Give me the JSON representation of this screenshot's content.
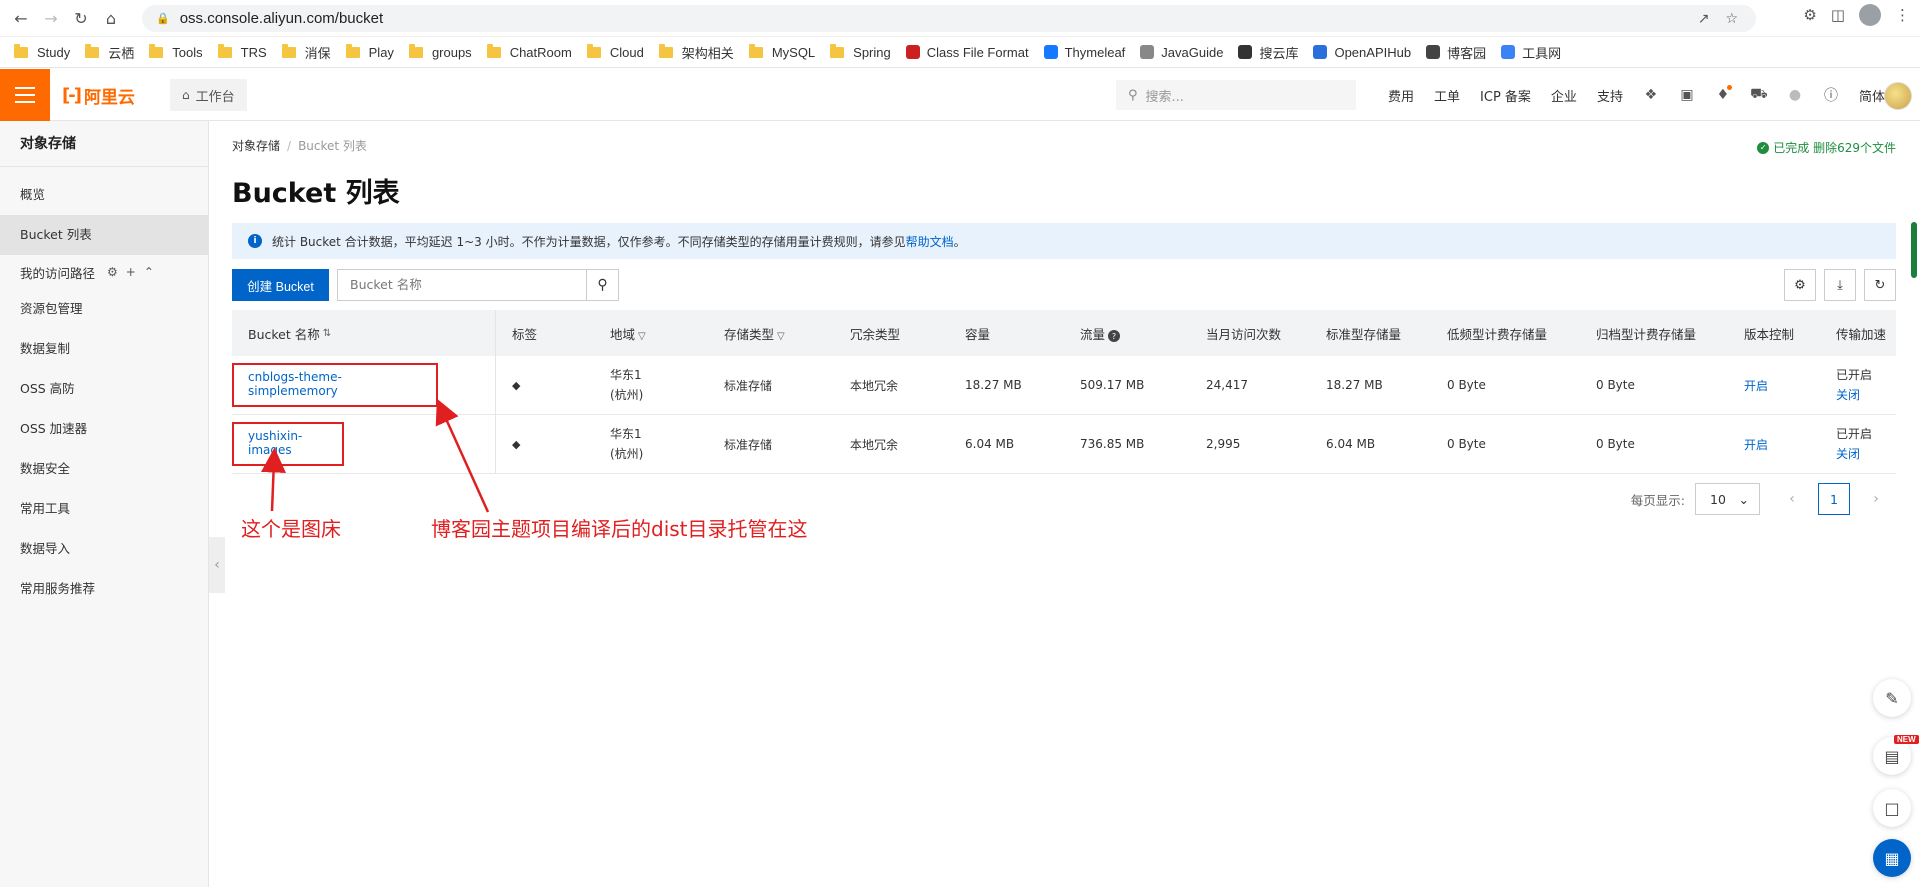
{
  "browser": {
    "url": "oss.console.aliyun.com/bucket",
    "bookmarks": [
      {
        "label": "Study",
        "type": "folder"
      },
      {
        "label": "云栖",
        "type": "folder"
      },
      {
        "label": "Tools",
        "type": "folder"
      },
      {
        "label": "TRS",
        "type": "folder"
      },
      {
        "label": "消保",
        "type": "folder"
      },
      {
        "label": "Play",
        "type": "folder"
      },
      {
        "label": "groups",
        "type": "folder"
      },
      {
        "label": "ChatRoom",
        "type": "folder"
      },
      {
        "label": "Cloud",
        "type": "folder"
      },
      {
        "label": "架构相关",
        "type": "folder"
      },
      {
        "label": "MySQL",
        "type": "folder"
      },
      {
        "label": "Spring",
        "type": "folder"
      },
      {
        "label": "Class File Format",
        "type": "site",
        "color": "#cc1f1f"
      },
      {
        "label": "Thymeleaf",
        "type": "site",
        "color": "#1677ff"
      },
      {
        "label": "JavaGuide",
        "type": "site",
        "color": "#888888"
      },
      {
        "label": "搜云库",
        "type": "site",
        "color": "#333333"
      },
      {
        "label": "OpenAPIHub",
        "type": "site",
        "color": "#2a6fdb"
      },
      {
        "label": "博客园",
        "type": "site",
        "color": "#444444"
      },
      {
        "label": "工具网",
        "type": "site",
        "color": "#3b82f6"
      }
    ]
  },
  "header": {
    "logo": "阿里云",
    "workbench": "工作台",
    "search_placeholder": "搜索...",
    "menu": [
      "费用",
      "工单",
      "ICP 备案",
      "企业",
      "支持"
    ],
    "lang": "简体"
  },
  "sidebar": {
    "title": "对象存储",
    "items_top": [
      "概览",
      "Bucket 列表"
    ],
    "group_label": "我的访问路径",
    "items_bottom": [
      "资源包管理",
      "数据复制",
      "OSS 高防",
      "OSS 加速器",
      "数据安全",
      "常用工具",
      "数据导入",
      "常用服务推荐"
    ]
  },
  "main": {
    "breadcrumb": [
      "对象存储",
      "Bucket 列表"
    ],
    "status": "已完成 删除629个文件",
    "title": "Bucket 列表",
    "banner_text": "统计 Bucket 合计数据，平均延迟 1~3 小时。不作为计量数据，仅作参考。不同存储类型的存储用量计费规则，请参见",
    "banner_link": "帮助文档",
    "banner_end": "。",
    "create_button": "创建 Bucket",
    "search_placeholder": "Bucket 名称"
  },
  "table": {
    "headers": [
      "Bucket 名称",
      "标签",
      "地域",
      "存储类型",
      "冗余类型",
      "容量",
      "流量",
      "当月访问次数",
      "标准型存储量",
      "低频型计费存储量",
      "归档型计费存储量",
      "版本控制",
      "传输加速"
    ],
    "rows": [
      {
        "name": "cnblogs-theme-simplememory",
        "region1": "华东1",
        "region2": "(杭州)",
        "storage": "标准存储",
        "redundancy": "本地冗余",
        "capacity": "18.27 MB",
        "traffic": "509.17 MB",
        "visits": "24,417",
        "standard": "18.27 MB",
        "ia": "0 Byte",
        "archive": "0 Byte",
        "versioning": "开启",
        "accel_status": "已开启",
        "accel_action": "关闭"
      },
      {
        "name": "yushixin-images",
        "region1": "华东1",
        "region2": "(杭州)",
        "storage": "标准存储",
        "redundancy": "本地冗余",
        "capacity": "6.04 MB",
        "traffic": "736.85 MB",
        "visits": "2,995",
        "standard": "6.04 MB",
        "ia": "0 Byte",
        "archive": "0 Byte",
        "versioning": "开启",
        "accel_status": "已开启",
        "accel_action": "关闭"
      }
    ]
  },
  "pager": {
    "label": "每页显示:",
    "page_size": "10",
    "current_page": "1"
  },
  "annotations": {
    "left": "这个是图床",
    "right": "博客园主题项目编译后的dist目录托管在这"
  },
  "float": {
    "new_badge": "NEW"
  }
}
